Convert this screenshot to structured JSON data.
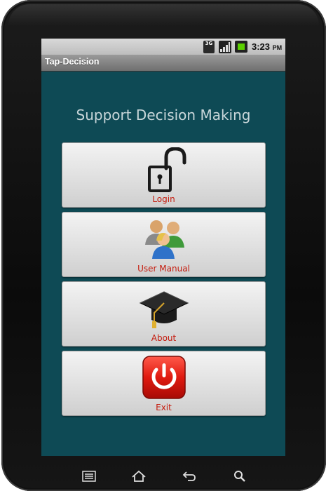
{
  "status_bar": {
    "network_type": "3G",
    "time": "3:23",
    "ampm": "PM",
    "signal_icon": "signal-bars-icon",
    "battery_icon": "battery-charging-icon"
  },
  "app": {
    "title": "Tap-Decision"
  },
  "main": {
    "heading": "Support Decision Making",
    "buttons": [
      {
        "label": "Login",
        "icon": "padlock-open-icon"
      },
      {
        "label": "User Manual",
        "icon": "users-group-icon"
      },
      {
        "label": "About",
        "icon": "graduation-cap-icon"
      },
      {
        "label": "Exit",
        "icon": "power-icon"
      }
    ]
  },
  "nav_bar": {
    "icons": [
      "menu-icon",
      "home-icon",
      "back-icon",
      "search-icon"
    ]
  },
  "colors": {
    "screen_background": "#0e4a55",
    "button_label": "#c51b0d",
    "heading": "#c9d7da"
  }
}
